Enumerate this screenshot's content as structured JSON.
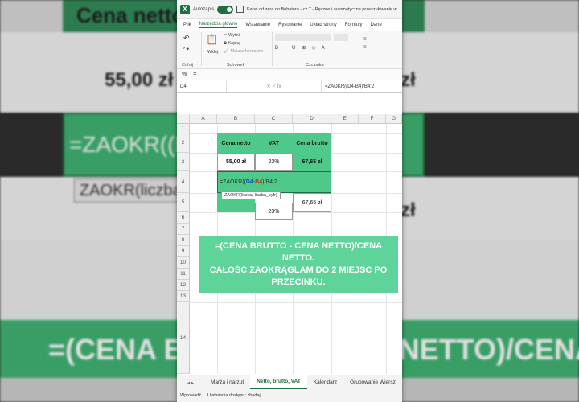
{
  "background": {
    "title": "Cena netto",
    "price": "55,00 zł",
    "right1": "zł",
    "right2": "zł",
    "formula": "=ZAOKR((D4-",
    "hint": "ZAOKR(liczba;",
    "bottom_banner": "=(CENA BRUTTO - CENA NETTO)/CENA"
  },
  "window": {
    "autosave_label": "Autozapis",
    "title": "Excel od zera do Bohatera - cz 7 - Ręczne i automatyczne przeszukiwanie w...",
    "tabs": [
      "Plik",
      "Narzędzia główne",
      "Wstawianie",
      "Rysowanie",
      "Układ strony",
      "Formuły",
      "Dane"
    ],
    "active_tab_index": 1,
    "ribbon": {
      "undo_label": "Cofnij",
      "paste_label": "Wklej",
      "cut_label": "Wytnij",
      "copy_label": "Kopiuj",
      "format_painter_label": "Malarz formatów",
      "clipboard_label": "Schowek",
      "font_label": "Czcionka",
      "font_glyphs": "B I U ⊞ ◇ A",
      "align_glyphs": "≡\n≡"
    },
    "number_row": {
      "percent": "%",
      "equals": "="
    },
    "name_box": "D4",
    "formula_bar": "=ZAOKR((D4-B4)/B4;2",
    "fx_icons": "✕ ✓ fx"
  },
  "grid": {
    "columns": [
      "A",
      "B",
      "C",
      "D",
      "E",
      "F",
      "G"
    ],
    "rows": [
      "1",
      "2",
      "3",
      "4",
      "5",
      "6",
      "7",
      "8",
      "9",
      "10",
      "11",
      "12",
      "13",
      "14"
    ],
    "headers": {
      "b2": "Cena netto",
      "c2": "VAT",
      "d2": "Cena brutto"
    },
    "row3": {
      "b3": "55,00 zł",
      "c3": "23%",
      "d3": "67,65 zł"
    },
    "row5": {
      "c5": "23%",
      "d5": "67,65 zł"
    },
    "edit": {
      "prefix": "=ZAOKR((",
      "ref1": "D4",
      "dash": "-",
      "ref2": "B4",
      "suffix": ")/B4;2"
    },
    "tooltip": "ZAOKR(liczba; liczba_cyfr)"
  },
  "callout": {
    "line1": "=(CENA BRUTTO - CENA NETTO)/CENA NETTO.",
    "line2": "CAŁOŚĆ ZAOKRĄGLAM DO 2 MIEJSC PO PRZECINKU."
  },
  "sheet_tabs": [
    "Marża i narzut",
    "Netto, brutto, VAT",
    "Kalendarz",
    "Grupowanie Wiersz"
  ],
  "active_sheet_index": 1,
  "sheet_nav": "◂ ▸",
  "status": {
    "mode": "Wprowadź",
    "accessibility": "Ułatwienia dostępu: zbadaj"
  },
  "colors": {
    "excel_green": "#1d6f42",
    "cell_green": "#4fc98a",
    "callout_green": "#5ed49a"
  }
}
